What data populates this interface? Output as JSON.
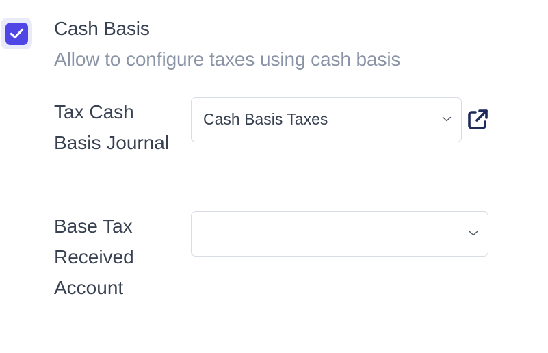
{
  "setting": {
    "title": "Cash Basis",
    "description": "Allow to configure taxes using cash basis",
    "enabled": true,
    "accent_color": "#4f46e5"
  },
  "fields": [
    {
      "label": "Tax Cash Basis Journal",
      "value": "Cash Basis Taxes",
      "has_external_link": true,
      "icons": [
        "chevron-down-icon",
        "external-link-icon"
      ]
    },
    {
      "label": "Base Tax Received Account",
      "value": "",
      "has_external_link": false,
      "icons": [
        "chevron-down-icon"
      ]
    }
  ]
}
